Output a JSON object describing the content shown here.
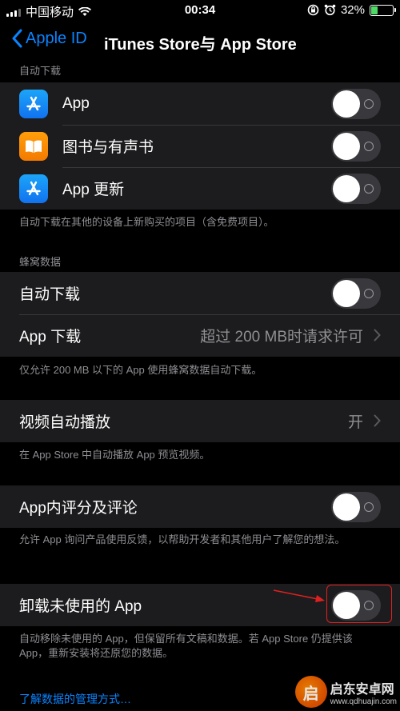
{
  "status": {
    "carrier": "中国移动",
    "time": "00:34",
    "battery": "32%",
    "battery_level": 0.32
  },
  "nav": {
    "back_label": "Apple ID",
    "title": "iTunes Store与 App Store"
  },
  "auto_downloads": {
    "header": "自动下载",
    "items": [
      {
        "label": "App",
        "icon": "app-store-icon",
        "on": false
      },
      {
        "label": "图书与有声书",
        "icon": "books-icon",
        "on": false
      },
      {
        "label": "App 更新",
        "icon": "app-store-icon",
        "on": false
      }
    ],
    "footer": "自动下载在其他的设备上新购买的项目（含免费项目）。"
  },
  "cellular": {
    "header": "蜂窝数据",
    "auto_download_label": "自动下载",
    "app_download_label": "App 下载",
    "app_download_value": "超过 200 MB时请求许可",
    "footer": "仅允许 200 MB 以下的 App 使用蜂窝数据自动下载。"
  },
  "video": {
    "label": "视频自动播放",
    "value": "开",
    "footer": "在 App Store 中自动播放 App 预览视频。"
  },
  "ratings": {
    "label": "App内评分及评论",
    "footer": "允许 App 询问产品使用反馈，以帮助开发者和其他用户了解您的想法。"
  },
  "offload": {
    "label": "卸载未使用的 App",
    "footer": "自动移除未使用的 App，但保留所有文稿和数据。若 App Store 仍提供该 App，重新安装将还原您的数据。"
  },
  "link": "了解数据的管理方式…",
  "watermark": {
    "name": "启东安卓网",
    "url": "www.qdhuajin.com"
  },
  "colors": {
    "accent": "#0a84ff",
    "background": "#000000",
    "cell": "#1c1c1e",
    "annotation": "#e02020"
  }
}
